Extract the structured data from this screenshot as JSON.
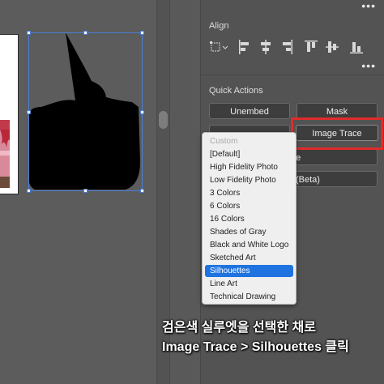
{
  "panel": {
    "align": {
      "title": "Align",
      "icons": [
        "align-to-selection-icon",
        "horizontal-align-left-icon",
        "horizontal-align-center-icon",
        "horizontal-align-right-icon",
        "vertical-align-top-icon",
        "vertical-align-center-icon",
        "vertical-align-bottom-icon"
      ]
    },
    "quick_actions": {
      "title": "Quick Actions",
      "unembed_label": "Unembed",
      "mask_label": "Mask",
      "image_trace_label": "Image Trace",
      "partial_label_1": "ge",
      "partial_label_2": "(Beta)"
    },
    "more_glyph": "•••"
  },
  "trace_menu": {
    "items": [
      {
        "label": "Custom",
        "state": "disabled"
      },
      {
        "label": "[Default]",
        "state": "normal"
      },
      {
        "label": "High Fidelity Photo",
        "state": "normal"
      },
      {
        "label": "Low Fidelity Photo",
        "state": "normal"
      },
      {
        "label": "3 Colors",
        "state": "normal"
      },
      {
        "label": "6 Colors",
        "state": "normal"
      },
      {
        "label": "16 Colors",
        "state": "normal"
      },
      {
        "label": "Shades of Gray",
        "state": "normal"
      },
      {
        "label": "Black and White Logo",
        "state": "normal"
      },
      {
        "label": "Sketched Art",
        "state": "normal"
      },
      {
        "label": "Silhouettes",
        "state": "selected"
      },
      {
        "label": "Line Art",
        "state": "normal"
      },
      {
        "label": "Technical Drawing",
        "state": "normal"
      }
    ]
  },
  "caption": {
    "line1": "검은색 실루엣을 선택한 채로",
    "line2": "Image Trace > Silhouettes 클릭"
  },
  "colors": {
    "highlight": "#e02b2b",
    "selection_accent": "#1f73e0",
    "selection_box": "#4a7fd6"
  }
}
